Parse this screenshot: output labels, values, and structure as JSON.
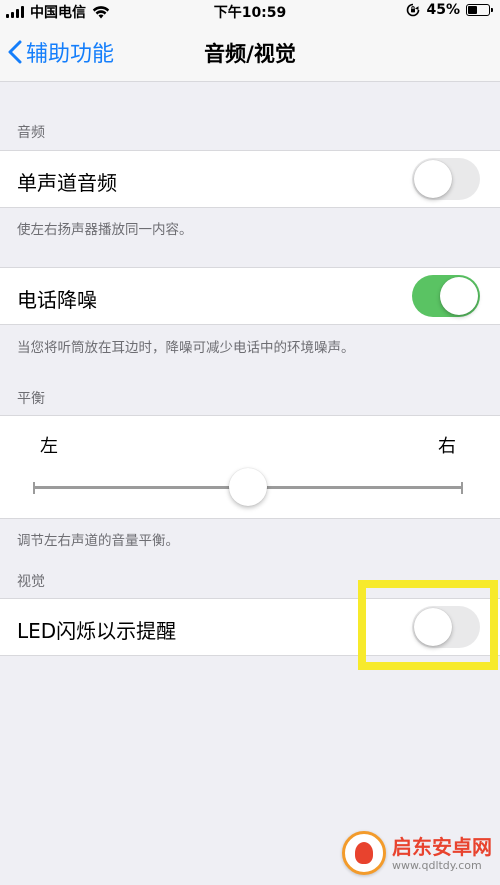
{
  "status_bar": {
    "carrier": "中国电信",
    "time": "下午10:59",
    "battery_percent": "45%",
    "battery_level": 0.45,
    "icons": [
      "signal-icon",
      "wifi-icon",
      "orientation-lock-icon",
      "battery-icon"
    ]
  },
  "nav": {
    "back_label": "辅助功能",
    "title": "音频/视觉"
  },
  "audio_section": {
    "header": "音频",
    "mono_audio": {
      "label": "单声道音频",
      "enabled": false
    },
    "mono_footer": "使左右扬声器播放同一内容。",
    "noise_cancel": {
      "label": "电话降噪",
      "enabled": true
    },
    "noise_footer": "当您将听筒放在耳边时，降噪可减少电话中的环境噪声。"
  },
  "balance_section": {
    "header": "平衡",
    "left_label": "左",
    "right_label": "右",
    "value": 0.5,
    "footer": "调节左右声道的音量平衡。"
  },
  "visual_section": {
    "header": "视觉",
    "led_flash": {
      "label": "LED闪烁以示提醒",
      "enabled": false
    }
  },
  "colors": {
    "accent": "#147efb",
    "toggle_on": "#5ac363",
    "toggle_off": "#e9e9ea",
    "highlight": "#f7ea2b",
    "background": "#efeff4"
  },
  "watermark": {
    "name": "启东安卓网",
    "url": "www.qdltdy.com"
  }
}
